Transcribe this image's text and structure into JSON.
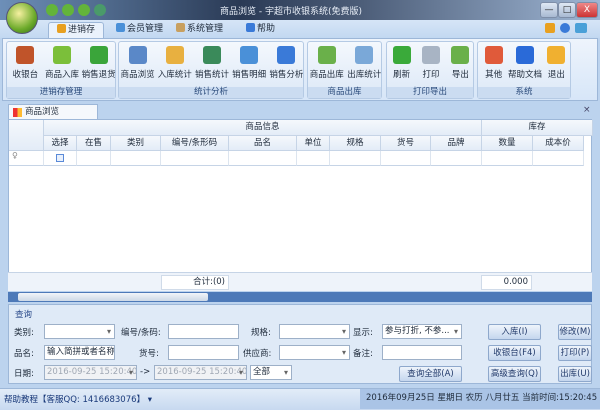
{
  "window": {
    "title": "商品浏览 - 宇超市收银系统(免费版)",
    "minimize": "—",
    "maximize": "□",
    "close": "X"
  },
  "tabs": [
    {
      "label": "进销存",
      "active": true,
      "icon": "box-icon"
    },
    {
      "label": "会员管理",
      "icon": "members-icon"
    },
    {
      "label": "系统管理",
      "icon": "tools-icon"
    },
    {
      "label": "帮助",
      "icon": "help-icon"
    }
  ],
  "ribbon": {
    "groups": [
      {
        "label": "进销存管理",
        "buttons": [
          {
            "label": "收银台",
            "icon": "cashier-icon",
            "color": "#c0542a"
          },
          {
            "label": "商品入库",
            "icon": "stock-in-icon",
            "color": "#7bbf3a"
          },
          {
            "label": "销售退货",
            "icon": "return-icon",
            "color": "#3aa53a"
          }
        ]
      },
      {
        "label": "统计分析",
        "buttons": [
          {
            "label": "商品浏览",
            "icon": "browse-icon",
            "color": "#5a88c8"
          },
          {
            "label": "入库统计",
            "icon": "stock-stats-icon",
            "color": "#e8b040"
          },
          {
            "label": "销售统计",
            "icon": "sales-stats-icon",
            "color": "#3a8a5a"
          },
          {
            "label": "销售明细",
            "icon": "sales-detail-icon",
            "color": "#4a90d8"
          },
          {
            "label": "销售分析",
            "icon": "pie-chart-icon",
            "color": "#3a7ad8"
          }
        ]
      },
      {
        "label": "商品出库",
        "buttons": [
          {
            "label": "商品出库",
            "icon": "stock-out-icon",
            "color": "#6ab04a"
          },
          {
            "label": "出库统计",
            "icon": "out-stats-icon",
            "color": "#7aa8d8"
          }
        ]
      },
      {
        "label": "打印导出",
        "buttons": [
          {
            "label": "刷新",
            "icon": "refresh-icon",
            "color": "#3aaa3a"
          },
          {
            "label": "打印",
            "icon": "printer-icon",
            "color": "#a8b4c4"
          },
          {
            "label": "导出",
            "icon": "export-icon",
            "color": "#6ab04a"
          }
        ]
      },
      {
        "label": "系统",
        "buttons": [
          {
            "label": "其他",
            "icon": "apps-icon",
            "color": "#e05a3a"
          },
          {
            "label": "帮助文档",
            "icon": "help-circle-icon",
            "color": "#2a6ad8"
          },
          {
            "label": "退出",
            "icon": "power-icon",
            "color": "#f0b030"
          }
        ]
      }
    ]
  },
  "document_tab": {
    "label": "商品浏览",
    "close": "×"
  },
  "grid": {
    "group_headers": [
      "商品信息",
      "库存"
    ],
    "columns": [
      "选择",
      "在售",
      "类别",
      "编号/条形码",
      "品名",
      "单位",
      "规格",
      "货号",
      "品牌",
      "数量",
      "成本价"
    ],
    "total_label": "合计:(0)",
    "total_qty": "0.000"
  },
  "query": {
    "title": "查询",
    "category_label": "类别:",
    "code_label": "编号/条码:",
    "spec_label": "规格:",
    "display_label": "显示:",
    "display_value": "参与打折, 不参...",
    "name_label": "品名:",
    "name_placeholder": "输入简拼或者名称",
    "item_no_label": "货号:",
    "supplier_label": "供应商:",
    "remark_label": "备注:",
    "date_label": "日期:",
    "date_from": "2016-09-25 15:20:40",
    "arrow": "->",
    "date_to": "2016-09-25 15:20:40",
    "range_value": "全部",
    "buttons": {
      "query_all": "查询全部(A)",
      "stock_in": "入库(I)",
      "modify": "修改(M)",
      "cashier": "收银台(F4)",
      "print": "打印(P)",
      "advanced": "高级查询(Q)",
      "stock_out": "出库(U)"
    }
  },
  "status": {
    "help": "帮助教程【客服QQ: 1416683076】 ▾",
    "datetime": "2016年09月25日 星期日 农历 八月廿五 当前时间:15:20:45"
  }
}
